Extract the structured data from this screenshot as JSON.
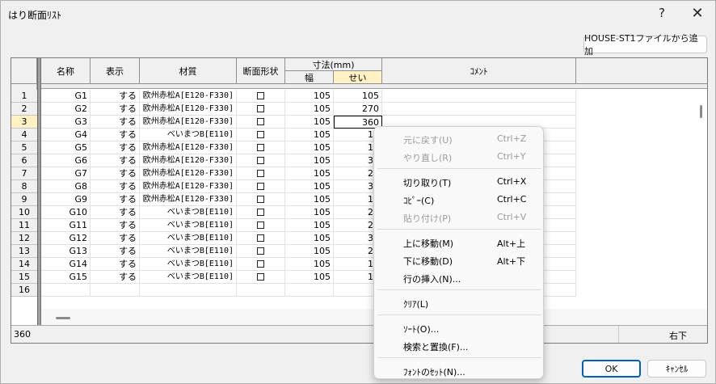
{
  "window": {
    "title": "はり断面ﾘｽﾄ",
    "help_glyph": "?",
    "close_glyph": "✕"
  },
  "buttons": {
    "import": "HOUSE-ST1ファイルから追加",
    "ok": "OK",
    "cancel": "ｷｬﾝｾﾙ"
  },
  "grid": {
    "headers": {
      "name": "名称",
      "display": "表示",
      "material": "材質",
      "shape": "断面形状",
      "dimension": "寸法(mm)",
      "width": "幅",
      "height": "せい",
      "comment": "ｺﾒﾝﾄ"
    },
    "row_numbers": [
      "1",
      "2",
      "3",
      "4",
      "5",
      "6",
      "7",
      "8",
      "9",
      "10",
      "11",
      "12",
      "13",
      "14",
      "15",
      "16"
    ],
    "rows": [
      {
        "name": "G1",
        "display": "する",
        "material": "欧州赤松A[E120-F330]",
        "width": "105",
        "height": "105"
      },
      {
        "name": "G2",
        "display": "する",
        "material": "欧州赤松A[E120-F330]",
        "width": "105",
        "height": "270"
      },
      {
        "name": "G3",
        "display": "する",
        "material": "欧州赤松A[E120-F330]",
        "width": "105",
        "height": "360"
      },
      {
        "name": "G4",
        "display": "する",
        "material": "べいまつB[E110]",
        "width": "105",
        "height": "10"
      },
      {
        "name": "G5",
        "display": "する",
        "material": "欧州赤松A[E120-F330]",
        "width": "105",
        "height": "18"
      },
      {
        "name": "G6",
        "display": "する",
        "material": "欧州赤松A[E120-F330]",
        "width": "105",
        "height": "39"
      },
      {
        "name": "G7",
        "display": "する",
        "material": "欧州赤松A[E120-F330]",
        "width": "105",
        "height": "24"
      },
      {
        "name": "G8",
        "display": "する",
        "material": "欧州赤松A[E120-F330]",
        "width": "105",
        "height": "33"
      },
      {
        "name": "G9",
        "display": "する",
        "material": "欧州赤松A[E120-F330]",
        "width": "105",
        "height": "15"
      },
      {
        "name": "G10",
        "display": "する",
        "material": "べいまつB[E110]",
        "width": "105",
        "height": "27"
      },
      {
        "name": "G11",
        "display": "する",
        "material": "べいまつB[E110]",
        "width": "105",
        "height": "24"
      },
      {
        "name": "G12",
        "display": "する",
        "material": "べいまつB[E110]",
        "width": "105",
        "height": "36"
      },
      {
        "name": "G13",
        "display": "する",
        "material": "べいまつB[E110]",
        "width": "105",
        "height": "21"
      },
      {
        "name": "G14",
        "display": "する",
        "material": "べいまつB[E110]",
        "width": "105",
        "height": "15"
      },
      {
        "name": "G15",
        "display": "する",
        "material": "べいまつB[E110]",
        "width": "105",
        "height": "18"
      }
    ]
  },
  "status": {
    "value": "360",
    "alignment": "右下"
  },
  "context_menu": [
    {
      "label": "元に戻す(U)",
      "shortcut": "Ctrl+Z",
      "enabled": false
    },
    {
      "label": "やり直し(R)",
      "shortcut": "Ctrl+Y",
      "enabled": false
    },
    {
      "separator": true
    },
    {
      "label": "切り取り(T)",
      "shortcut": "Ctrl+X",
      "enabled": true
    },
    {
      "label": "ｺﾋﾟｰ(C)",
      "shortcut": "Ctrl+C",
      "enabled": true
    },
    {
      "label": "貼り付け(P)",
      "shortcut": "Ctrl+V",
      "enabled": false
    },
    {
      "separator": true
    },
    {
      "label": "上に移動(M)",
      "shortcut": "Alt+上",
      "enabled": true
    },
    {
      "label": "下に移動(D)",
      "shortcut": "Alt+下",
      "enabled": true
    },
    {
      "label": "行の挿入(N)...",
      "shortcut": "",
      "enabled": true
    },
    {
      "separator": true
    },
    {
      "label": "ｸﾘｱ(L)",
      "shortcut": "",
      "enabled": true
    },
    {
      "separator": true
    },
    {
      "label": "ｿｰﾄ(O)...",
      "shortcut": "",
      "enabled": true
    },
    {
      "label": "検索と置換(F)...",
      "shortcut": "",
      "enabled": true
    },
    {
      "separator": true
    },
    {
      "label": "ﾌｫﾝﾄのｾｯﾄ(N)...",
      "shortcut": "",
      "enabled": true
    }
  ],
  "colors": {
    "selection_highlight": "#fff1c4",
    "ok_border": "#005fb8"
  }
}
